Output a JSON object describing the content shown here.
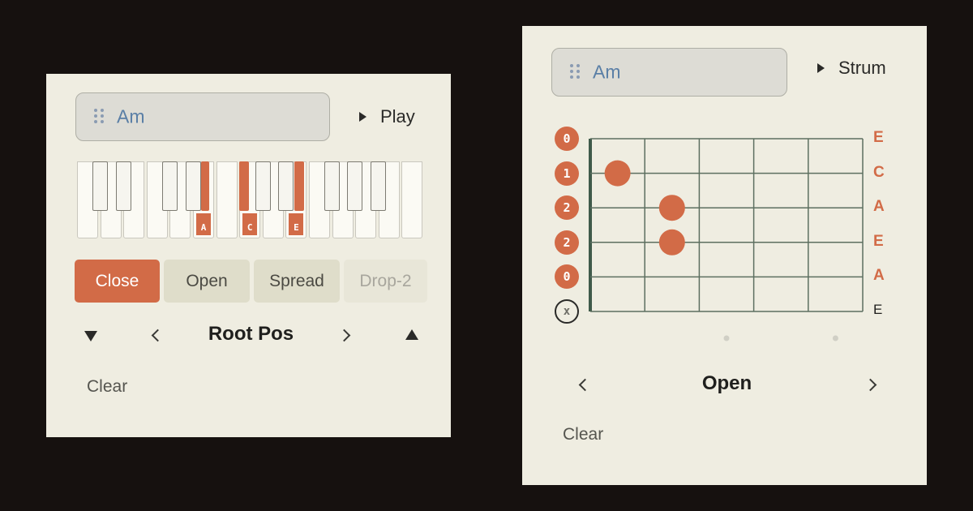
{
  "piano_panel": {
    "chord": "Am",
    "play_label": "Play",
    "active_notes": {
      "A": "A",
      "C": "C",
      "E": "E"
    },
    "voicings": [
      {
        "label": "Close",
        "state": "selected"
      },
      {
        "label": "Open",
        "state": "normal"
      },
      {
        "label": "Spread",
        "state": "normal"
      },
      {
        "label": "Drop-2",
        "state": "disabled"
      }
    ],
    "inversion_label": "Root Pos",
    "clear_label": "Clear"
  },
  "guitar_panel": {
    "chord": "Am",
    "strum_label": "Strum",
    "strings": [
      {
        "label": "E",
        "fret": "0",
        "state": "on",
        "label_color": "#d26b47"
      },
      {
        "label": "C",
        "fret": "1",
        "state": "on",
        "label_color": "#d26b47"
      },
      {
        "label": "A",
        "fret": "2",
        "state": "on",
        "label_color": "#d26b47"
      },
      {
        "label": "E",
        "fret": "2",
        "state": "on",
        "label_color": "#d26b47"
      },
      {
        "label": "A",
        "fret": "0",
        "state": "on",
        "label_color": "#d26b47"
      },
      {
        "label": "E",
        "fret": "x",
        "state": "muted",
        "label_color": "#1f1f1d"
      }
    ],
    "fretted_notes": [
      {
        "string": 1,
        "fret": 1
      },
      {
        "string": 2,
        "fret": 2
      },
      {
        "string": 3,
        "fret": 2
      }
    ],
    "position_label": "Open",
    "clear_label": "Clear"
  },
  "colors": {
    "accent": "#d26b47",
    "card_bg": "#efede1",
    "page_bg": "#16110f",
    "chord_text": "#5a7fa6"
  }
}
